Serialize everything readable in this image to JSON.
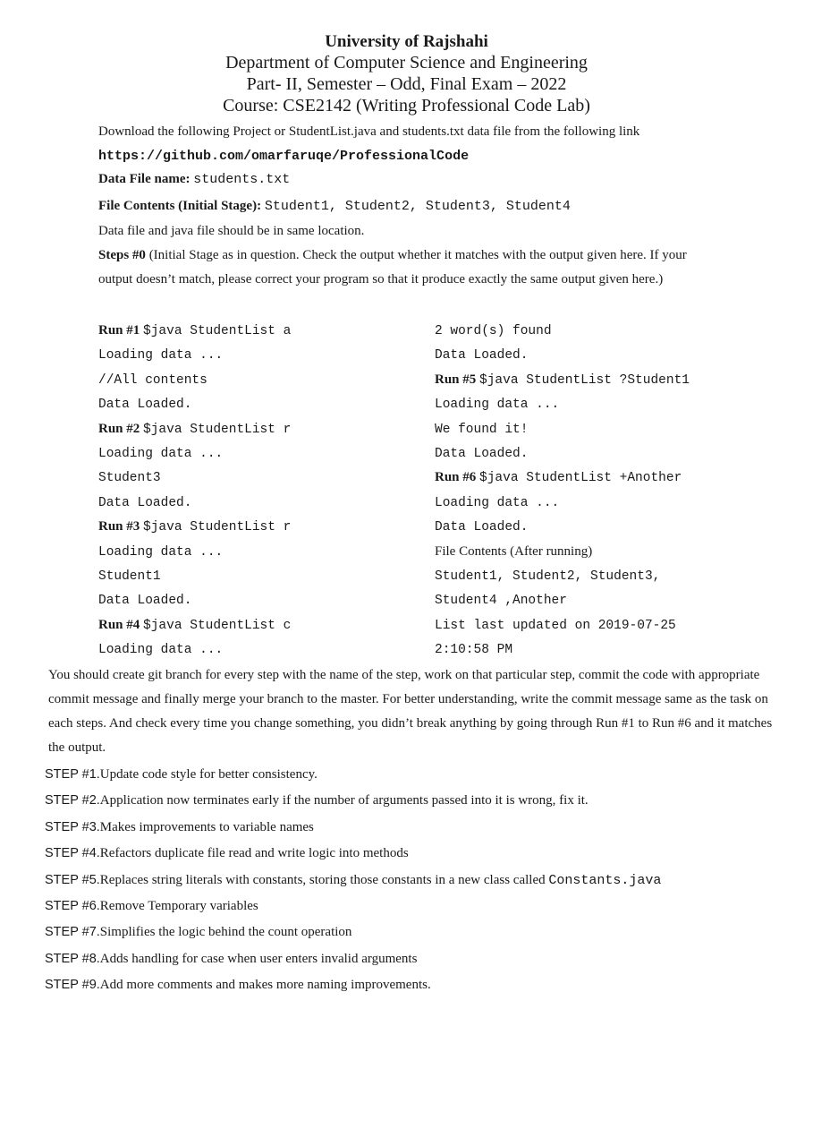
{
  "header": {
    "university": "University of Rajshahi",
    "department": "Department of Computer Science and Engineering",
    "exam": "Part- II, Semester – Odd, Final Exam – 2022",
    "course": "Course: CSE2142 (Writing Professional Code Lab)"
  },
  "intro": {
    "download_text": "Download the following Project or StudentList.java and students.txt data  file from the following link",
    "link": "https://github.com/omarfaruqe/ProfessionalCode",
    "data_file_label": "Data File name:",
    "data_file_value": "students.txt",
    "contents_label": "File Contents (Initial Stage):",
    "contents_value": "Student1, Student2, Student3, Student4",
    "same_location": "Data file and java file should be in same location.",
    "steps0_label": "Steps #0",
    "steps0_text": " (Initial Stage as in question. Check the output whether it matches with the output given here. If your output doesn’t match, please correct your program so that it produce exactly the same output given here.)"
  },
  "runs_left": [
    {
      "label": "Run #1",
      "text": "$java StudentList a"
    },
    {
      "label": "",
      "text": "Loading data ..."
    },
    {
      "label": "",
      "text": "//All contents"
    },
    {
      "label": "",
      "text": "Data Loaded."
    },
    {
      "label": "Run #2",
      "text": "$java StudentList r"
    },
    {
      "label": "",
      "text": "Loading data ..."
    },
    {
      "label": "",
      "text": "Student3"
    },
    {
      "label": "",
      "text": "Data Loaded."
    },
    {
      "label": "Run #3",
      "text": "$java StudentList r"
    },
    {
      "label": "",
      "text": "Loading data ..."
    },
    {
      "label": "",
      "text": "Student1"
    },
    {
      "label": "",
      "text": "Data Loaded."
    },
    {
      "label": "Run #4",
      "text": "$java StudentList c"
    },
    {
      "label": "",
      "text": "Loading data ..."
    }
  ],
  "runs_right": [
    {
      "label": "",
      "text": "2 word(s) found",
      "serif": false
    },
    {
      "label": "",
      "text": "Data Loaded.",
      "serif": false
    },
    {
      "label": "Run #5",
      "text": "$java StudentList ?Student1",
      "serif": false
    },
    {
      "label": "",
      "text": "Loading data ...",
      "serif": false
    },
    {
      "label": "",
      "text": "We found it!",
      "serif": false
    },
    {
      "label": "",
      "text": "Data Loaded.",
      "serif": false
    },
    {
      "label": "Run #6",
      "text": "$java StudentList +Another",
      "serif": false
    },
    {
      "label": "",
      "text": "Loading data ...",
      "serif": false
    },
    {
      "label": "",
      "text": "Data Loaded.",
      "serif": false
    },
    {
      "label": "",
      "text": "File Contents (After running)",
      "serif": true
    },
    {
      "label": "",
      "text": "Student1, Student2, Student3,",
      "serif": false
    },
    {
      "label": "",
      "text": "Student4 ,Another",
      "serif": false
    },
    {
      "label": "",
      "text": "List last updated on 2019-07-25",
      "serif": false
    },
    {
      "label": "",
      "text": "2:10:58 PM",
      "serif": false
    }
  ],
  "instructions": "You should create git branch for every step with the name of the step, work on that particular step, commit the code with appropriate commit message and finally merge your branch to the master. For better understanding, write the commit message same as the task on each steps. And check every time you change something, you didn’t break anything by going through Run #1 to Run #6 and it matches the output.",
  "steps": [
    {
      "tag": "STEP #1.",
      "text": "Update code style for better consistency."
    },
    {
      "tag": "STEP #2.",
      "text": "Application now terminates early if the number of arguments passed into it is wrong, fix it."
    },
    {
      "tag": "STEP #3.",
      "text": "Makes improvements to variable names"
    },
    {
      "tag": "STEP #4.",
      "text": "Refactors duplicate file read and write logic into methods"
    },
    {
      "tag": "STEP #5.",
      "text": "Replaces string literals with constants, storing those constants in a new class called ",
      "code": "Constants.java"
    },
    {
      "tag": "STEP #6.",
      "text": "Remove Temporary variables"
    },
    {
      "tag": "STEP #7.",
      "text": "Simplifies the logic behind the count operation"
    },
    {
      "tag": "STEP #8.",
      "text": "Adds handling for case when user enters invalid arguments"
    },
    {
      "tag": "STEP #9.",
      "text": "Add more comments and makes more naming improvements."
    }
  ]
}
